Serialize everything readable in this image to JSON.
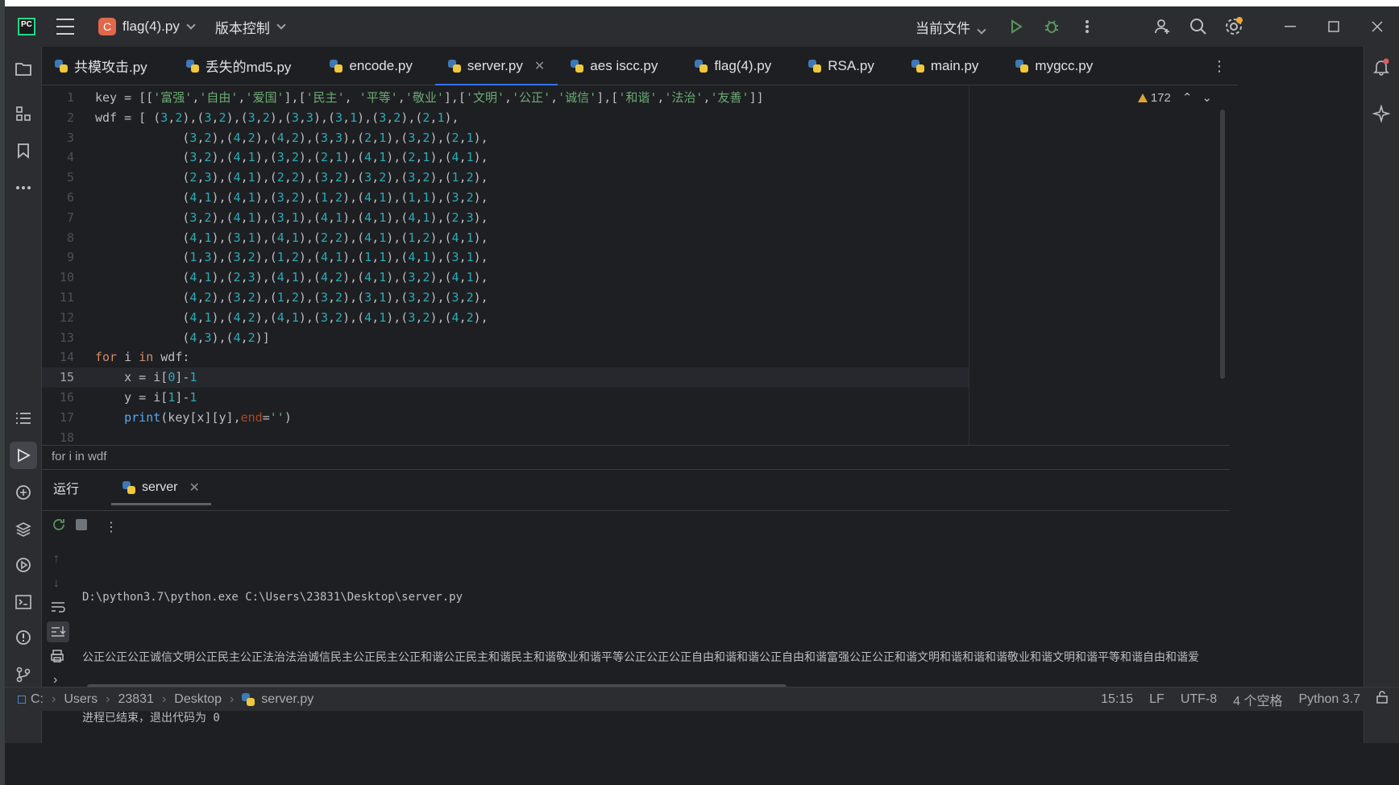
{
  "titlebar": {
    "project_initial": "C",
    "project_name": "flag(4).py",
    "vcs_label": "版本控制",
    "run_config": "当前文件"
  },
  "tabs": [
    {
      "label": "共模攻击.py",
      "active": false
    },
    {
      "label": "丢失的md5.py",
      "active": false
    },
    {
      "label": "encode.py",
      "active": false
    },
    {
      "label": "server.py",
      "active": true
    },
    {
      "label": "aes iscc.py",
      "active": false
    },
    {
      "label": "flag(4).py",
      "active": false
    },
    {
      "label": "RSA.py",
      "active": false
    },
    {
      "label": "main.py",
      "active": false
    },
    {
      "label": "mygcc.py",
      "active": false
    }
  ],
  "editor": {
    "warning_count": "172",
    "current_line": 15,
    "line_numbers": [
      "1",
      "2",
      "3",
      "4",
      "5",
      "6",
      "7",
      "8",
      "9",
      "10",
      "11",
      "12",
      "13",
      "14",
      "15",
      "16",
      "17",
      "18"
    ],
    "lines": [
      "key = [['富强','自由','爱国'],['民主', '平等','敬业'],['文明','公正','诚信'],['和谐','法治','友善']]",
      "wdf = [ (3,2),(3,2),(3,2),(3,3),(3,1),(3,2),(2,1),",
      "            (3,2),(4,2),(4,2),(3,3),(2,1),(3,2),(2,1),",
      "            (3,2),(4,1),(3,2),(2,1),(4,1),(2,1),(4,1),",
      "            (2,3),(4,1),(2,2),(3,2),(3,2),(3,2),(1,2),",
      "            (4,1),(4,1),(3,2),(1,2),(4,1),(1,1),(3,2),",
      "            (3,2),(4,1),(3,1),(4,1),(4,1),(4,1),(2,3),",
      "            (4,1),(3,1),(4,1),(2,2),(4,1),(1,2),(4,1),",
      "            (1,3),(3,2),(1,2),(4,1),(1,1),(4,1),(3,1),",
      "            (4,1),(2,3),(4,1),(4,2),(4,1),(3,2),(4,1),",
      "            (4,2),(3,2),(1,2),(3,2),(3,1),(3,2),(3,2),",
      "            (4,1),(4,2),(4,1),(3,2),(4,1),(3,2),(4,2),",
      "            (4,3),(4,2)]",
      "for i in wdf:",
      "    x = i[0]-1",
      "    y = i[1]-1",
      "    print(key[x][y],end='')",
      ""
    ],
    "breadcrumb": "for i in wdf"
  },
  "run_panel": {
    "title": "运行",
    "tab_label": "server",
    "console_lines": [
      "D:\\python3.7\\python.exe C:\\Users\\23831\\Desktop\\server.py",
      "公正公正公正诚信文明公正民主公正法治法治诚信民主公正民主公正和谐公正民主和谐民主和谐敬业和谐平等公正公正公正自由和谐和谐公正自由和谐富强公正公正和谐文明和谐和谐和谐敬业和谐文明和谐平等和谐自由和谐爱",
      "进程已结束，退出代码为 0"
    ]
  },
  "statusbar": {
    "path": [
      "C:",
      "Users",
      "23831",
      "Desktop",
      "server.py"
    ],
    "cursor_pos": "15:15",
    "line_sep": "LF",
    "encoding": "UTF-8",
    "indent": "4 个空格",
    "interpreter": "Python 3.7"
  },
  "colors": {
    "accent": "#3574f0",
    "keyword": "#cf8e6d",
    "string": "#6aab73",
    "number": "#2aacb8",
    "warning": "#e0a531"
  }
}
